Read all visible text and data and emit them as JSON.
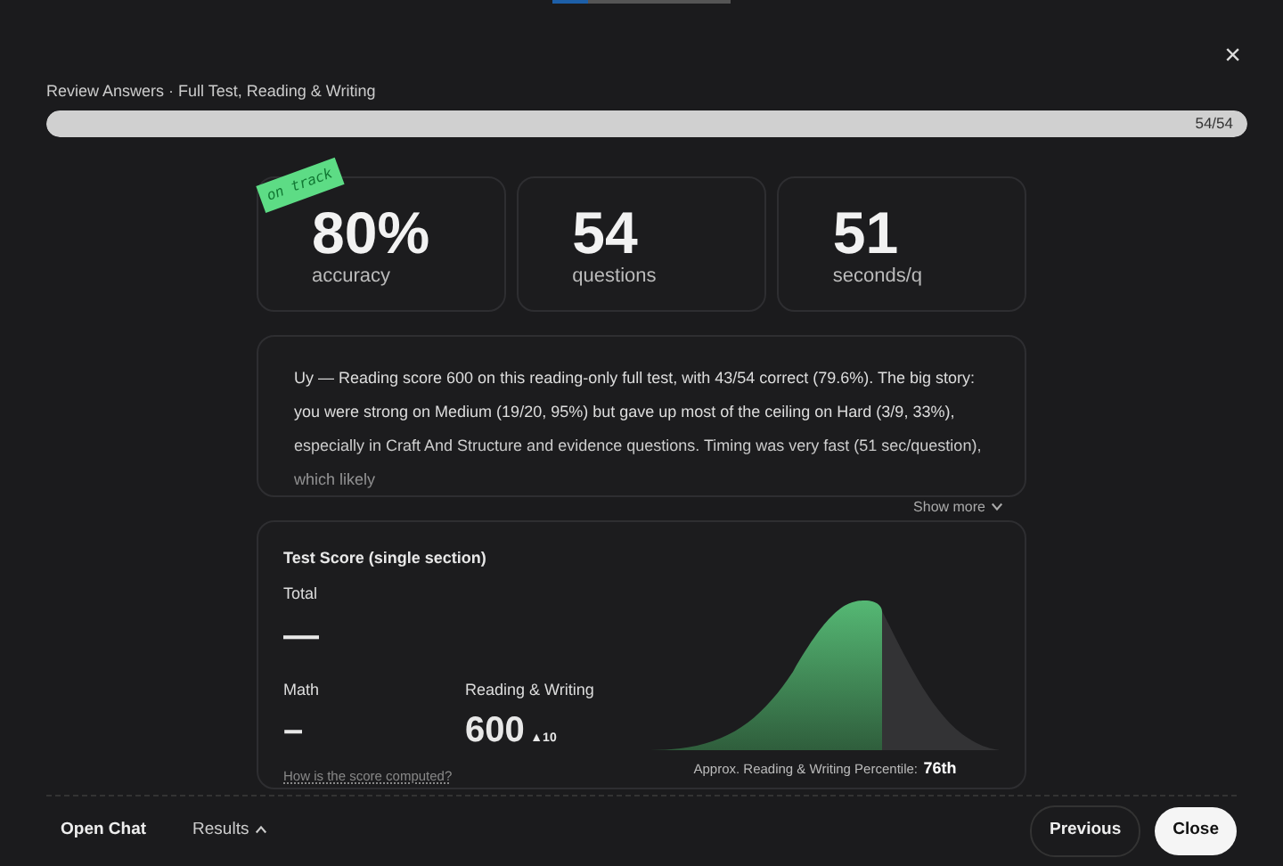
{
  "header": {
    "title": "Review Answers · Full Test, Reading & Writing",
    "close_icon": "×"
  },
  "progress": {
    "level": 1,
    "reading": "54/54"
  },
  "stats": [
    {
      "value": "80%",
      "label": "accuracy",
      "tag": "on track"
    },
    {
      "value": "54",
      "label": "questions"
    },
    {
      "value": "51",
      "label": "seconds/q"
    }
  ],
  "summary": {
    "text": "Uy — Reading score 600 on this reading-only full test, with 43/54 correct (79.6%). The big story: you were strong on Medium (19/20, 95%) but gave up most of the ceiling on Hard (3/9, 33%), especially in Craft And Structure and evidence questions. Timing was very fast (51 sec/question), which likely",
    "toggle": "Show more"
  },
  "score": {
    "title": "Test Score (single section)",
    "total_label": "Total",
    "total_value": "—",
    "sections": [
      {
        "label": "Math",
        "value": "–"
      },
      {
        "label": "Reading & Writing",
        "value": "600",
        "delta": "▲10"
      }
    ],
    "help_link": "How is the score computed?",
    "percentile_label": "Approx. Reading & Writing Percentile:",
    "percentile_value": "76th"
  },
  "footer": {
    "left": [
      {
        "label": "Open Chat",
        "kind": "plain"
      },
      {
        "label": "Results",
        "kind": "menu"
      }
    ],
    "right": [
      {
        "label": "Previous",
        "kind": "outline"
      },
      {
        "label": "Close",
        "kind": "solid"
      }
    ]
  }
}
